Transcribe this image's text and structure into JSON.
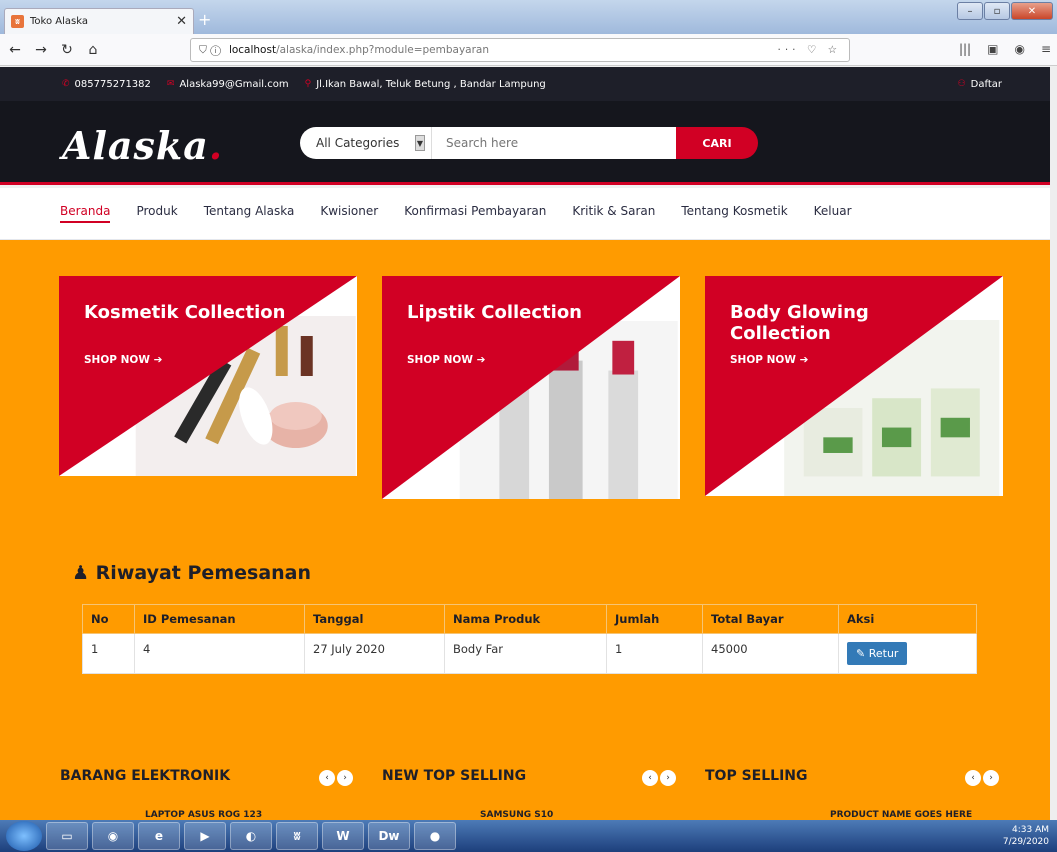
{
  "browser": {
    "tab_title": "Toko Alaska",
    "url_host": "localhost",
    "url_path": "/alaska/index.php?module=pembayaran"
  },
  "site": {
    "phone": "085775271382",
    "email": "Alaska99@Gmail.com",
    "address": "Jl.Ikan Bawal, Teluk Betung , Bandar Lampung",
    "daftar_label": "Daftar",
    "logo_text": "Alaska",
    "logo_dot": ".",
    "search": {
      "category": "All Categories",
      "placeholder": "Search here",
      "button": "CARI"
    },
    "nav": [
      "Beranda",
      "Produk",
      "Tentang Alaska",
      "Kwisioner",
      "Konfirmasi Pembayaran",
      "Kritik & Saran",
      "Tentang Kosmetik",
      "Keluar"
    ]
  },
  "collections": [
    {
      "title": "Kosmetik Collection",
      "cta": "SHOP NOW ➔"
    },
    {
      "title": "Lipstik Collection",
      "cta": "SHOP NOW ➔"
    },
    {
      "title": "Body Glowing Collection",
      "cta": "SHOP NOW ➔"
    }
  ],
  "riwayat": {
    "heading": "Riwayat Pemesanan",
    "columns": [
      "No",
      "ID Pemesanan",
      "Tanggal",
      "Nama Produk",
      "Jumlah",
      "Total Bayar",
      "Aksi"
    ],
    "rows": [
      {
        "no": "1",
        "id": "4",
        "tanggal": "27 July 2020",
        "produk": "Body Far",
        "jumlah": "1",
        "total": "45000",
        "aksi": "Retur"
      }
    ]
  },
  "sections": [
    {
      "title": "BARANG ELEKTRONIK",
      "product": "LAPTOP ASUS ROG 123"
    },
    {
      "title": "NEW TOP SELLING",
      "product": "SAMSUNG S10"
    },
    {
      "title": "TOP SELLING",
      "product": "PRODUCT NAME GOES HERE"
    }
  ],
  "tray": {
    "time": "4:33 AM",
    "date": "7/29/2020"
  },
  "colors": {
    "accent": "#d10024",
    "main_bg": "#ff9b00",
    "header_bg": "#15161d"
  }
}
